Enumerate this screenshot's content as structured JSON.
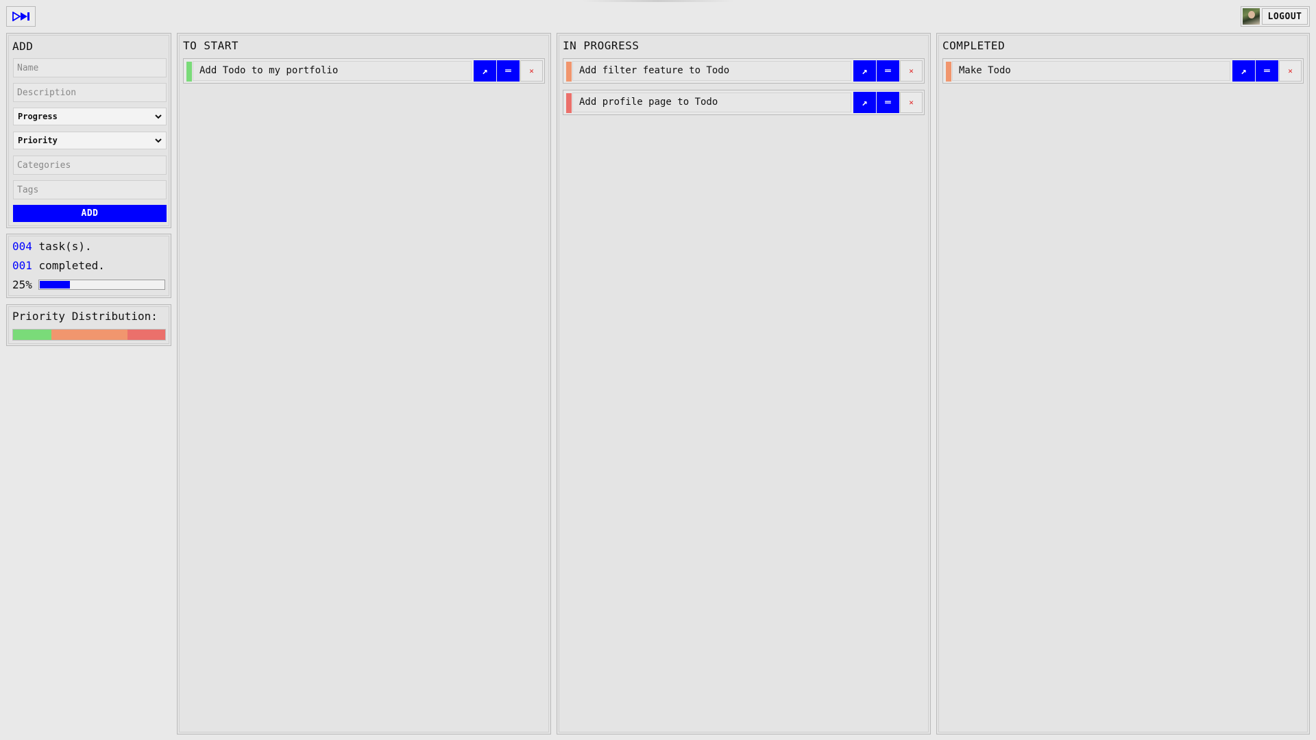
{
  "header": {
    "logout_label": "LOGOUT"
  },
  "add_form": {
    "title": "ADD",
    "name_placeholder": "Name",
    "description_placeholder": "Description",
    "progress_select": "Progress",
    "priority_select": "Priority",
    "categories_placeholder": "Categories",
    "tags_placeholder": "Tags",
    "add_label": "ADD"
  },
  "stats": {
    "task_count": "004",
    "task_label": "task(s).",
    "completed_count": "001",
    "completed_label": "completed.",
    "percent_label": "25%",
    "percent": 25
  },
  "priority": {
    "title": "Priority Distribution:",
    "segments": [
      {
        "level": "low",
        "color": "#7adb79",
        "fraction": 0.25
      },
      {
        "level": "medium",
        "color": "#f1966e",
        "fraction": 0.5
      },
      {
        "level": "high",
        "color": "#eb706b",
        "fraction": 0.25
      }
    ]
  },
  "columns": {
    "to_start": {
      "title": "TO START",
      "items": [
        {
          "name": "Add Todo to my portfolio",
          "priority_color": "#7adb79"
        }
      ]
    },
    "in_progress": {
      "title": "IN PROGRESS",
      "items": [
        {
          "name": "Add filter feature to Todo",
          "priority_color": "#f1966e"
        },
        {
          "name": "Add profile page to Todo",
          "priority_color": "#eb706b"
        }
      ]
    },
    "completed": {
      "title": "COMPLETED",
      "items": [
        {
          "name": "Make Todo",
          "priority_color": "#f1966e"
        }
      ]
    }
  },
  "item_buttons": {
    "open_glyph": "↗",
    "edit_glyph": "═",
    "delete_glyph": "✕"
  },
  "colors": {
    "accent": "#0000ff",
    "delete": "#e02020",
    "background": "#e9e9e9"
  }
}
